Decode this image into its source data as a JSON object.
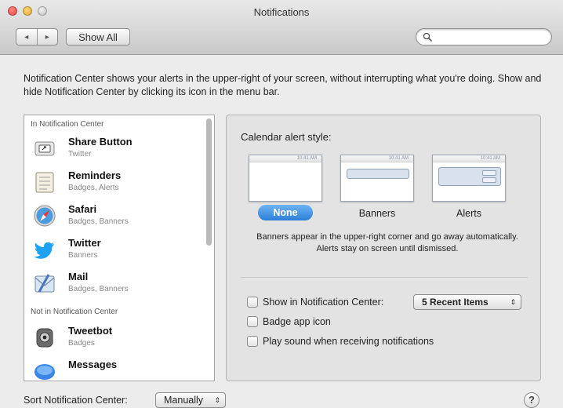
{
  "window": {
    "title": "Notifications"
  },
  "toolbar": {
    "back_label": "◂",
    "forward_label": "▸",
    "show_all_label": "Show All",
    "search_placeholder": "",
    "search_value": ""
  },
  "description": "Notification Center shows your alerts in the upper-right of your screen, without interrupting what you're doing. Show and hide Notification Center by clicking its icon in the menu bar.",
  "app_list": {
    "in_section_label": "In Notification Center",
    "not_in_section_label": "Not in Notification Center",
    "in_items": [
      {
        "name": "Share Button",
        "detail": "Twitter",
        "icon": "share-button-icon"
      },
      {
        "name": "Reminders",
        "detail": "Badges, Alerts",
        "icon": "reminders-icon"
      },
      {
        "name": "Safari",
        "detail": "Badges, Banners",
        "icon": "safari-icon"
      },
      {
        "name": "Twitter",
        "detail": "Banners",
        "icon": "twitter-icon"
      },
      {
        "name": "Mail",
        "detail": "Badges, Banners",
        "icon": "mail-icon"
      }
    ],
    "not_in_items": [
      {
        "name": "Tweetbot",
        "detail": "Badges",
        "icon": "tweetbot-icon"
      },
      {
        "name": "Messages",
        "detail": "",
        "icon": "messages-icon"
      }
    ]
  },
  "alert_style": {
    "title": "Calendar alert style:",
    "options": [
      "None",
      "Banners",
      "Alerts"
    ],
    "selected": "None",
    "thumb_time": "10:41 AM",
    "help": "Banners appear in the upper-right corner and go away automatically. Alerts stay on screen until dismissed."
  },
  "options": {
    "show_in_nc_label": "Show in Notification Center:",
    "show_in_nc_checked": false,
    "recent_items_value": "5 Recent Items",
    "badge_label": "Badge app icon",
    "badge_checked": false,
    "sound_label": "Play sound when receiving notifications",
    "sound_checked": false
  },
  "footer": {
    "sort_label": "Sort Notification Center:",
    "sort_value": "Manually",
    "help_label": "?"
  },
  "colors": {
    "accent": "#2c7fd8",
    "close": "#e0443e",
    "minimize": "#e2a72b",
    "twitter": "#1da1f2"
  }
}
